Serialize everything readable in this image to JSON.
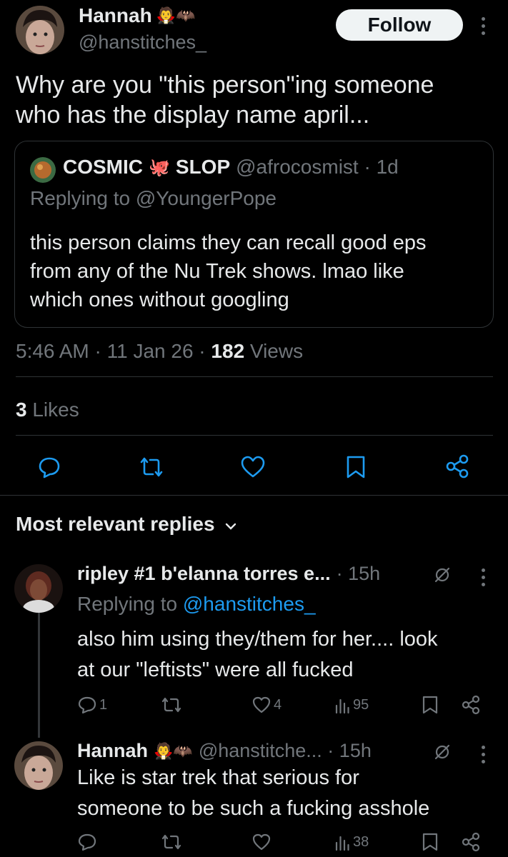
{
  "main_tweet": {
    "display_name": "Hannah",
    "name_emojis": "🧛🦇",
    "handle": "@hanstitches_",
    "follow_label": "Follow",
    "text_line1": "Why are you \"this person\"ing someone",
    "text_line2": "who has the display name april...",
    "quote": {
      "name_a": "COSMIC",
      "name_emoji": "🐙",
      "name_b": "SLOP",
      "handle_time": "@afrocosmist · 1d",
      "replying_prefix": "Replying to",
      "replying_handle": "@YoungerPope",
      "line1": "this person claims they can recall good eps",
      "line2": "from any of the Nu Trek shows. lmao like",
      "line3": "which ones without googling"
    },
    "time": "5:46 AM · 11 Jan 26 · ",
    "views_count": "182",
    "views_label": " Views",
    "likes_count": "3",
    "likes_label": " Likes"
  },
  "replies_header": {
    "label": "Most relevant replies"
  },
  "replies": [
    {
      "name": "ripley #1 b'elanna torres e...",
      "time": "· 15h",
      "replying_prefix": "Replying to ",
      "replying_handle": "@hanstitches_",
      "line1": "also him using they/them for her.... look",
      "line2": "at our \"leftists\" were all fucked",
      "reply_count": "1",
      "like_count": "4",
      "view_count": "95"
    },
    {
      "name": "Hannah",
      "name_emojis": "🧛🦇",
      "handle_time": "@hanstitche... · 15h",
      "line1": "Like is star trek that serious for",
      "line2": "someone to be such a fucking asshole",
      "view_count": "38"
    }
  ],
  "colors": {
    "accent": "#1d9bf0",
    "muted": "#71767b",
    "text": "#e7e9ea",
    "background": "#000000"
  }
}
